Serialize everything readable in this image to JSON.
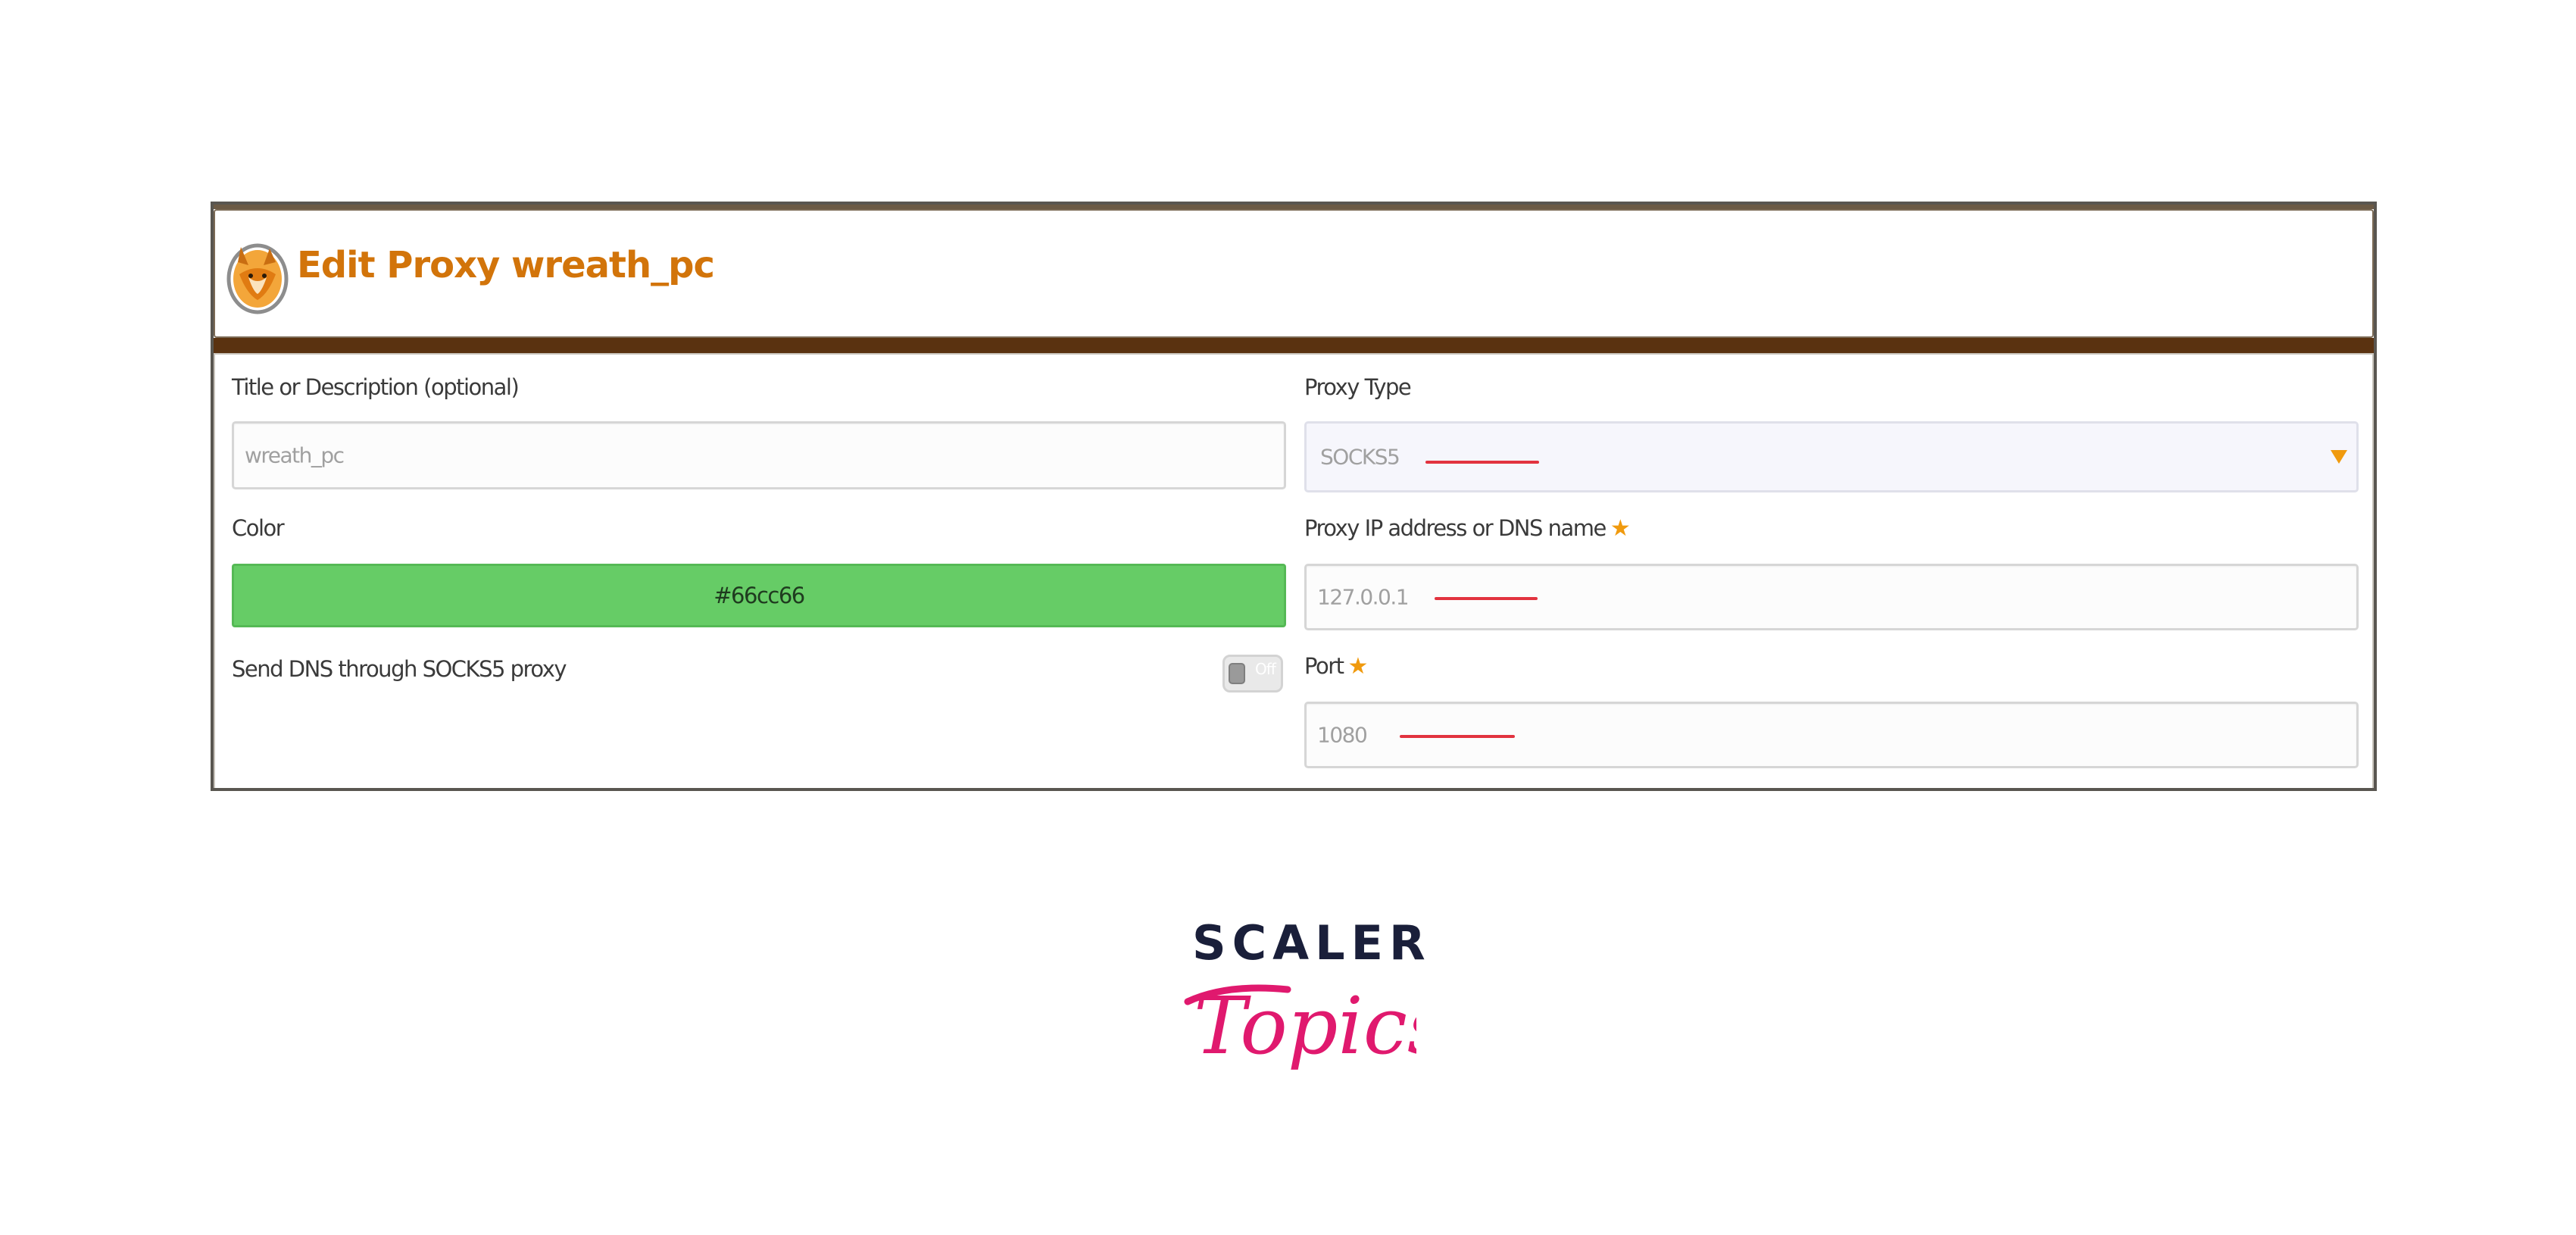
{
  "header": {
    "title": "Edit Proxy wreath_pc",
    "icon": "foxyproxy-fox-icon"
  },
  "form": {
    "title_field": {
      "label": "Title or Description (optional)",
      "value": "wreath_pc"
    },
    "color_field": {
      "label": "Color",
      "value": "#66cc66",
      "swatch": "#66cc66"
    },
    "dns_toggle": {
      "label": "Send DNS through SOCKS5 proxy",
      "state": "Off"
    },
    "proxy_type": {
      "label": "Proxy Type",
      "value": "SOCKS5"
    },
    "proxy_ip": {
      "label": "Proxy IP address or DNS name",
      "value": "127.0.0.1"
    },
    "port": {
      "label": "Port",
      "value": "1080"
    }
  },
  "logo": {
    "line1": "SCALER",
    "line2": "Topics"
  },
  "colors": {
    "title_orange": "#d2740a",
    "required_star": "#f09a0e",
    "brown_bar": "#5a3210",
    "annotation_red": "#e2333f",
    "logo_navy": "#1a1f3a",
    "logo_pink": "#e0196e"
  }
}
